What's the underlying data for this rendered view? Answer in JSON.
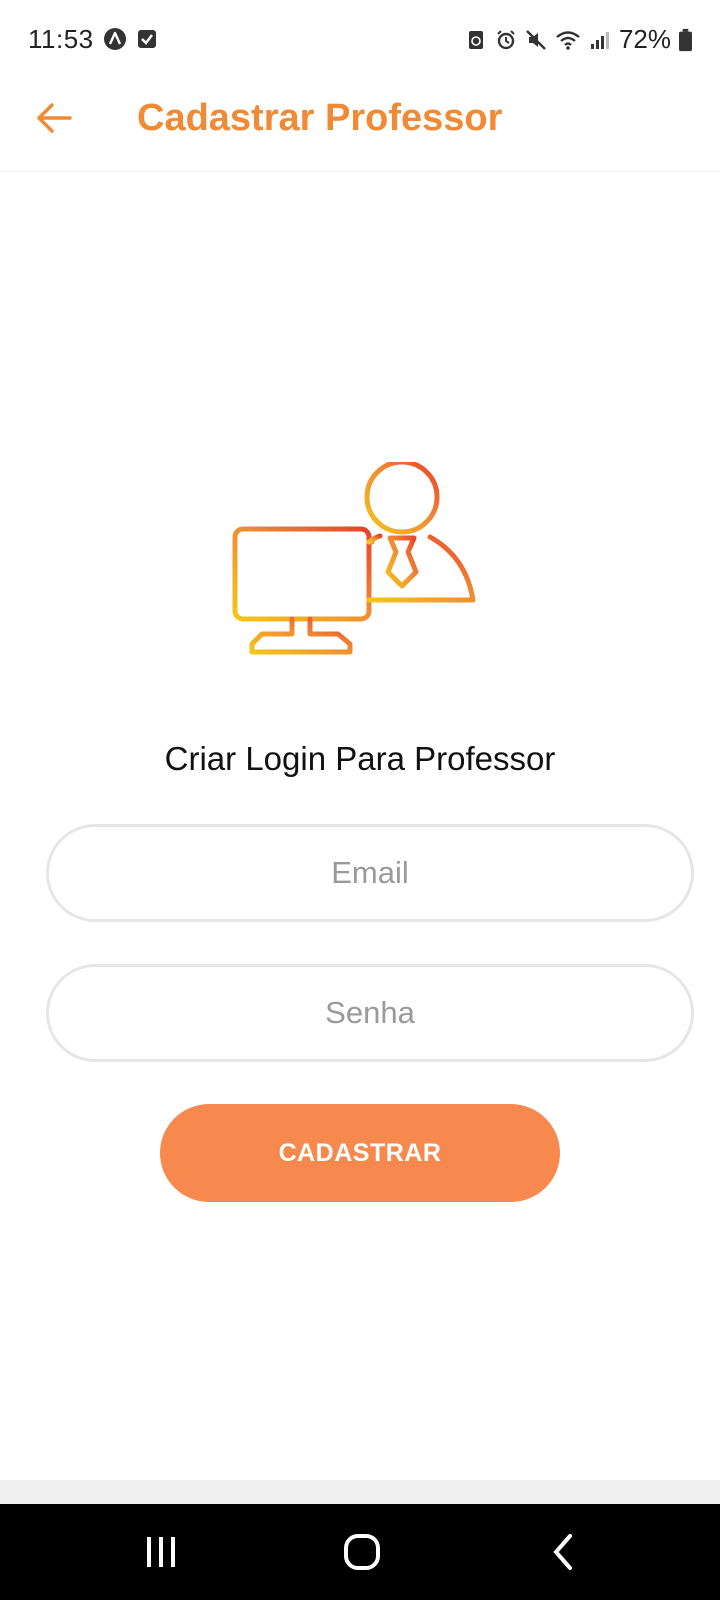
{
  "status_bar": {
    "time": "11:53",
    "battery": "72%",
    "left_icons": [
      "app-a-icon",
      "checkbox-notification-icon"
    ],
    "right_icons": [
      "recycle-icon",
      "alarm-icon",
      "mute-icon",
      "wifi-icon",
      "signal-icon",
      "battery-icon"
    ]
  },
  "app_bar": {
    "title": "Cadastrar Professor",
    "back_icon": "arrow-left-icon"
  },
  "illustration": {
    "icon": "teacher-computer-icon",
    "gradient_start": "#F5C518",
    "gradient_end": "#E8412B"
  },
  "form": {
    "heading": "Criar Login Para Professor",
    "email": {
      "value": "",
      "placeholder": "Email"
    },
    "senha": {
      "value": "",
      "placeholder": "Senha"
    },
    "submit_label": "CADASTRAR"
  },
  "colors": {
    "accent": "#F08A35",
    "button": "#F8894E",
    "nav_bar": "#000000"
  },
  "nav_bar": {
    "buttons": [
      "recents-icon",
      "home-icon",
      "back-chevron-icon"
    ]
  }
}
